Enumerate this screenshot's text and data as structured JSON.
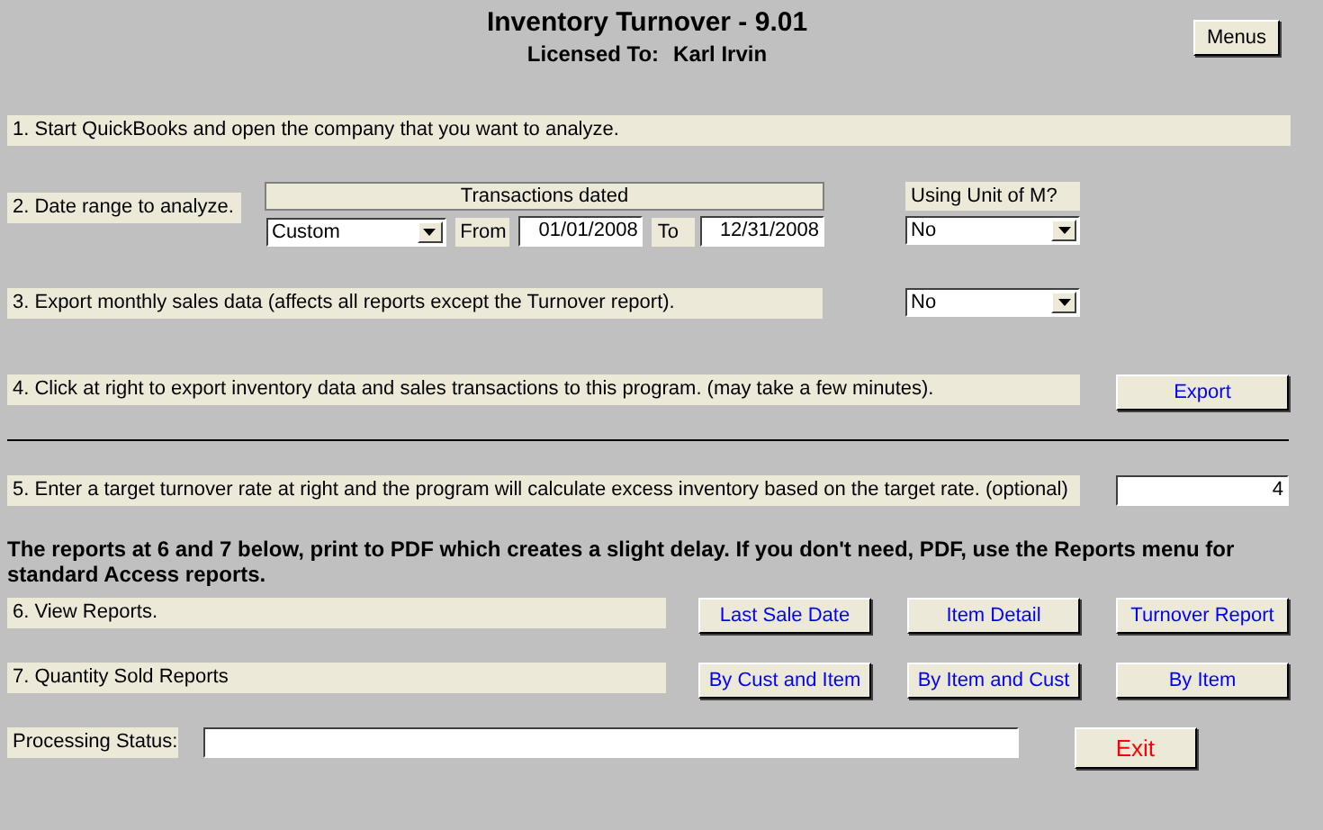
{
  "header": {
    "title": "Inventory Turnover - 9.01",
    "license_label": "Licensed To:",
    "license_name": "Karl Irvin",
    "menus_button": "Menus"
  },
  "step1": {
    "label": "1. Start QuickBooks and open the company that you want to analyze."
  },
  "step2": {
    "label": "2. Date range to analyze.",
    "group_title": "Transactions dated",
    "range": "Custom",
    "from_label": "From",
    "from": "01/01/2008",
    "to_label": "To",
    "to": "12/31/2008",
    "unit_label": "Using Unit of M?",
    "unit_value": "No"
  },
  "step3": {
    "label": "3. Export monthly sales data (affects all reports except the Turnover report).",
    "value": "No"
  },
  "step4": {
    "label": "4. Click at right to export inventory data and sales transactions to this program. (may take a few minutes).",
    "button": "Export"
  },
  "step5": {
    "label": "5. Enter a target turnover rate at right and the program will calculate excess inventory based on the target rate. (optional)",
    "value": "4"
  },
  "note": "The reports at 6 and 7 below, print to PDF which creates a slight delay. If you don't need, PDF, use the Reports menu for standard Access reports.",
  "report_rows": [
    {
      "label": "6. View Reports.",
      "buttons": [
        "Last Sale Date",
        "Item Detail",
        "Turnover Report"
      ]
    },
    {
      "label": "7. Quantity Sold Reports",
      "buttons": [
        "By Cust and Item",
        "By Item and Cust",
        "By Item"
      ]
    }
  ],
  "status": {
    "label": "Processing Status:",
    "exit_button": "Exit"
  }
}
